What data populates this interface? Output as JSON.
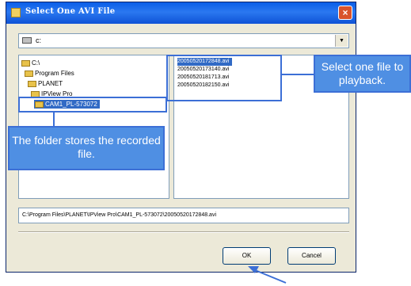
{
  "dialog": {
    "title": "Select One AVI File",
    "close_label": "×"
  },
  "drive": {
    "value": "c:",
    "arrow": "▼"
  },
  "folders": [
    {
      "label": "C:\\"
    },
    {
      "label": "Program Files"
    },
    {
      "label": "PLANET"
    },
    {
      "label": "IPView Pro"
    },
    {
      "label": "CAM1_PL-573072"
    }
  ],
  "files": [
    {
      "label": "20050520172848.avi"
    },
    {
      "label": "20050520173140.avi"
    },
    {
      "label": "20050520181713.avi"
    },
    {
      "label": "20050520182150.avi"
    }
  ],
  "path": {
    "value": "C:\\Program Files\\PLANET\\IPView Pro\\CAM1_PL-573072\\20050520172848.avi"
  },
  "buttons": {
    "ok": "OK",
    "cancel": "Cancel"
  },
  "callouts": {
    "file": "Select one file to playback.",
    "folder": "The folder stores the recorded file."
  },
  "colors": {
    "title_bar": "#0a5ee8",
    "selection": "#316ac5",
    "callout_fill": "#4f8fe3",
    "callout_border": "#3c6fd6",
    "dialog_face": "#ece9d8"
  },
  "icons": [
    "drive-icon",
    "folder-icon",
    "close-icon",
    "chevron-down-icon",
    "pointer-arrow"
  ]
}
